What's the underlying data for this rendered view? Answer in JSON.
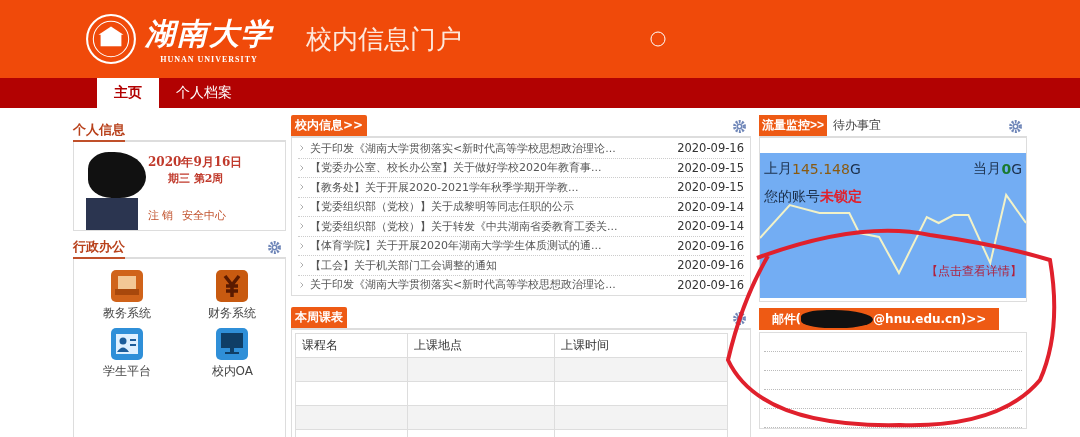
{
  "header": {
    "logo_text": "湖南大学",
    "logo_subtitle": "HUNAN UNIVERSITY",
    "title": "校内信息门户"
  },
  "nav_tabs": [
    {
      "label": "主页",
      "selected": true
    },
    {
      "label": "个人档案",
      "selected": false
    }
  ],
  "personal_info": {
    "heading": "个人信息",
    "date": "2020年9月16日",
    "week": "期三  第2周",
    "links": [
      "注 销",
      "安全中心"
    ]
  },
  "admin_office": {
    "heading": "行政办公",
    "apps": [
      {
        "label": "教务系统",
        "kind": "book"
      },
      {
        "label": "财务系统",
        "kind": "yuan"
      },
      {
        "label": "学生平台",
        "kind": "person"
      },
      {
        "label": "校内OA",
        "kind": "monitor"
      }
    ]
  },
  "campus_news": {
    "heading": "校内信息>>",
    "items": [
      {
        "title": "关于印发《湖南大学贯彻落实<新时代高等学校思想政治理论...",
        "date": "2020-09-16"
      },
      {
        "title": "【党委办公室、校长办公室】关于做好学校2020年教育事...",
        "date": "2020-09-15"
      },
      {
        "title": "【教务处】关于开展2020-2021学年秋季学期开学教...",
        "date": "2020-09-15"
      },
      {
        "title": "【党委组织部（党校）】关于成黎明等同志任职的公示",
        "date": "2020-09-14"
      },
      {
        "title": "【党委组织部（党校）】关于转发《中共湖南省委教育工委关...",
        "date": "2020-09-14"
      },
      {
        "title": "【体育学院】关于开展2020年湖南大学学生体质测试的通...",
        "date": "2020-09-16"
      },
      {
        "title": "【工会】关于机关部门工会调整的通知",
        "date": "2020-09-16"
      },
      {
        "title": "关于印发《湖南大学贯彻落实<新时代高等学校思想政治理论...",
        "date": "2020-09-16"
      }
    ]
  },
  "schedule": {
    "heading": "本周课表",
    "columns": [
      "课程名",
      "上课地点",
      "上课时间"
    ]
  },
  "traffic": {
    "tabs": [
      {
        "label": "流量监控>>",
        "selected": true
      },
      {
        "label": "待办事宜",
        "selected": false
      }
    ],
    "last_month_label": "上月",
    "last_month_value": "145.148",
    "last_month_unit": "G",
    "this_month_label": "当月",
    "this_month_value": "0",
    "this_month_unit": "G",
    "account_label": "您的账号",
    "account_status": "未锁定",
    "details_link": "【点击查看详情】"
  },
  "mail": {
    "prefix": "邮件(",
    "suffix": "@hnu.edu.cn)>>"
  }
}
